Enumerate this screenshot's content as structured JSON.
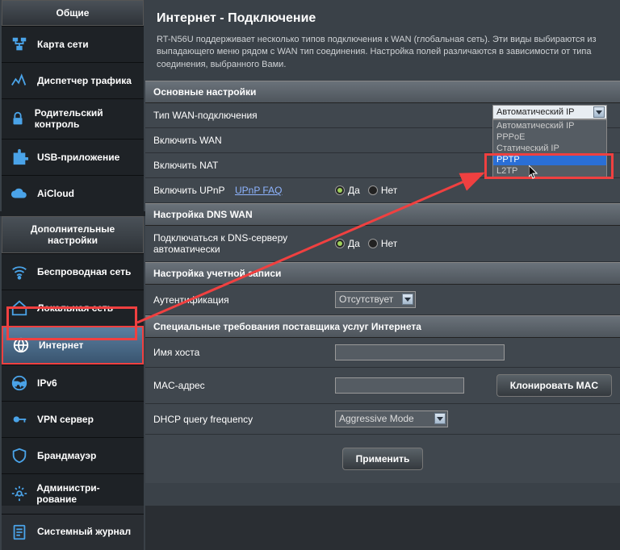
{
  "sidebar": {
    "general_header": "Общие",
    "items_general": [
      {
        "label": "Карта сети"
      },
      {
        "label": "Диспетчер трафика"
      },
      {
        "label": "Родительский контроль"
      },
      {
        "label": "USB-приложение"
      },
      {
        "label": "AiCloud"
      }
    ],
    "advanced_header": "Дополнительные настройки",
    "items_advanced": [
      {
        "label": "Беспроводная сеть"
      },
      {
        "label": "Локальная сеть"
      },
      {
        "label": "Интернет"
      },
      {
        "label": "IPv6"
      },
      {
        "label": "VPN сервер"
      },
      {
        "label": "Брандмауэр"
      },
      {
        "label": "Администри-рование"
      },
      {
        "label": "Системный журнал"
      }
    ]
  },
  "page": {
    "title": "Интернет - Подключение",
    "desc": "RT-N56U поддерживает несколько типов подключения к WAN (глобальная сеть). Эти виды выбираются из выпадающего меню рядом с WAN тип соединения. Настройка полей различаются в зависимости от типа соединения, выбранного Вами."
  },
  "sections": {
    "basic": "Основные настройки",
    "dns": "Настройка DNS WAN",
    "account": "Настройка учетной записи",
    "isp": "Специальные требования поставщика услуг Интернета"
  },
  "labels": {
    "wan_type": "Тип WAN-подключения",
    "enable_wan": "Включить WAN",
    "enable_nat": "Включить NAT",
    "enable_upnp": "Включить UPnP",
    "upnp_link": "UPnP FAQ",
    "dns_auto": "Подключаться к DNS-серверу автоматически",
    "auth": "Аутентификация",
    "hostname": "Имя хоста",
    "mac": "MAC-адрес",
    "dhcp_freq": "DHCP query frequency"
  },
  "values": {
    "wan_type_selected": "Автоматический IP",
    "auth_selected": "Отсутствует",
    "dhcp_selected": "Aggressive Mode",
    "yes": "Да",
    "no": "Нет"
  },
  "dropdown": {
    "options": [
      "Автоматический IP",
      "PPPoE",
      "Статический IP",
      "PPTP",
      "L2TP"
    ]
  },
  "buttons": {
    "clone_mac": "Клонировать MAC",
    "apply": "Применить"
  }
}
